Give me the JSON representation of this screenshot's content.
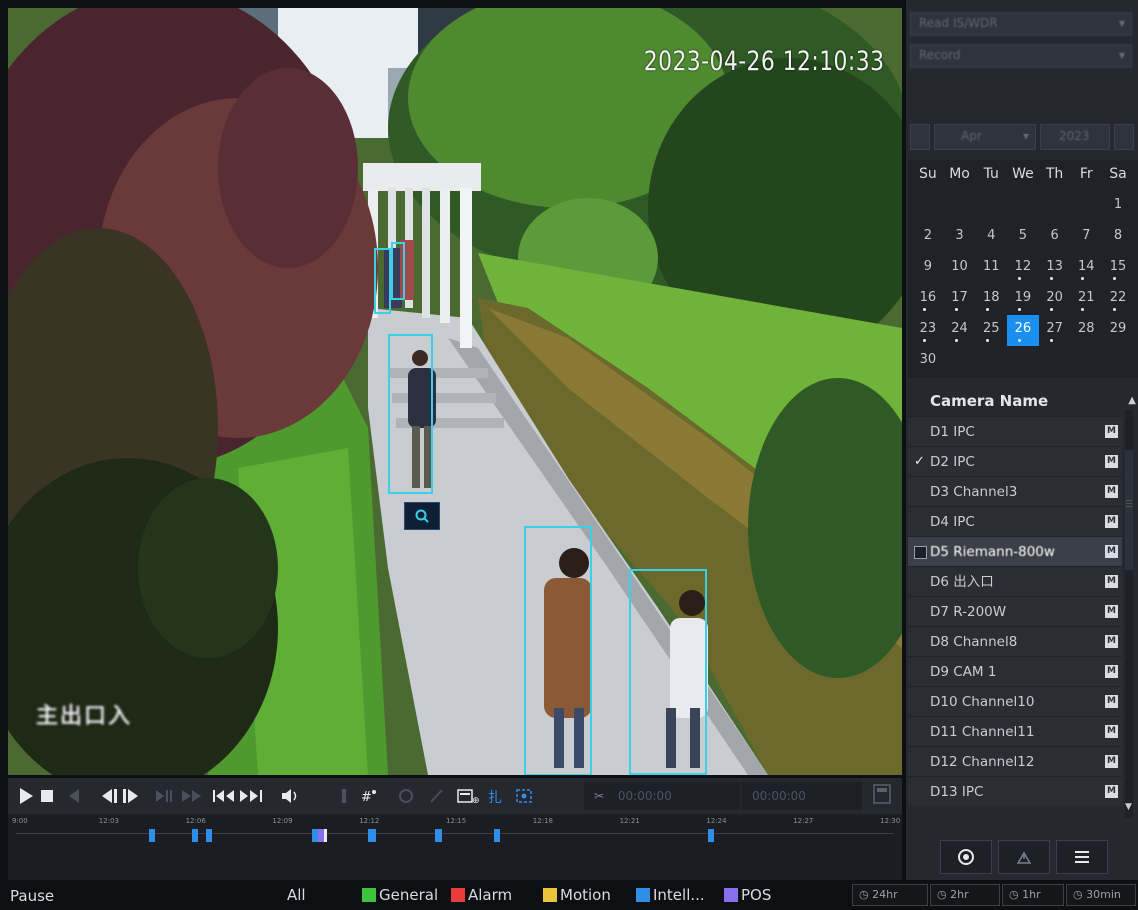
{
  "video": {
    "timestamp": "2023-04-26 12:10:33",
    "channel_label": "主出口入"
  },
  "panel": {
    "dropdown1": "Read IS/WDR",
    "dropdown2": "Record",
    "month": "Apr",
    "year": "2023",
    "weekdays": [
      "Su",
      "Mo",
      "Tu",
      "We",
      "Th",
      "Fr",
      "Sa"
    ],
    "days": [
      {
        "d": "",
        "dot": false
      },
      {
        "d": "",
        "dot": false
      },
      {
        "d": "",
        "dot": false
      },
      {
        "d": "",
        "dot": false
      },
      {
        "d": "",
        "dot": false
      },
      {
        "d": "",
        "dot": false
      },
      {
        "d": "1",
        "dot": false
      },
      {
        "d": "2",
        "dot": false
      },
      {
        "d": "3",
        "dot": false
      },
      {
        "d": "4",
        "dot": false
      },
      {
        "d": "5",
        "dot": false
      },
      {
        "d": "6",
        "dot": false
      },
      {
        "d": "7",
        "dot": false
      },
      {
        "d": "8",
        "dot": false
      },
      {
        "d": "9",
        "dot": false
      },
      {
        "d": "10",
        "dot": false
      },
      {
        "d": "11",
        "dot": false
      },
      {
        "d": "12",
        "dot": true
      },
      {
        "d": "13",
        "dot": true
      },
      {
        "d": "14",
        "dot": true
      },
      {
        "d": "15",
        "dot": true
      },
      {
        "d": "16",
        "dot": true
      },
      {
        "d": "17",
        "dot": true
      },
      {
        "d": "18",
        "dot": true
      },
      {
        "d": "19",
        "dot": true
      },
      {
        "d": "20",
        "dot": true
      },
      {
        "d": "21",
        "dot": true
      },
      {
        "d": "22",
        "dot": true
      },
      {
        "d": "23",
        "dot": true
      },
      {
        "d": "24",
        "dot": true
      },
      {
        "d": "25",
        "dot": true
      },
      {
        "d": "26",
        "dot": true,
        "selected": true
      },
      {
        "d": "27",
        "dot": true
      },
      {
        "d": "28",
        "dot": false
      },
      {
        "d": "29",
        "dot": false
      },
      {
        "d": "30",
        "dot": false
      }
    ],
    "camera_header": "Camera Name",
    "cameras": [
      {
        "name": "D1 IPC",
        "checked": false
      },
      {
        "name": "D2 IPC",
        "checked": true
      },
      {
        "name": "D3 Channel3",
        "checked": false
      },
      {
        "name": "D4 IPC",
        "checked": false
      },
      {
        "name": "D5 Riemann-800w",
        "checked": false,
        "highlight": true
      },
      {
        "name": "D6 出入口",
        "checked": false
      },
      {
        "name": "D7 R-200W",
        "checked": false
      },
      {
        "name": "D8 Channel8",
        "checked": false
      },
      {
        "name": "D9 CAM 1",
        "checked": false
      },
      {
        "name": "D10 Channel10",
        "checked": false
      },
      {
        "name": "D11 Channel11",
        "checked": false
      },
      {
        "name": "D12 Channel12",
        "checked": false
      },
      {
        "name": "D13 IPC",
        "checked": false
      }
    ],
    "camera_badge": "M"
  },
  "toolbar": {
    "start_time": "00:00:00",
    "end_time": "00:00:00"
  },
  "timeline": {
    "ticks": [
      "9:00",
      "12:03",
      "12:06",
      "12:09",
      "12:12",
      "12:15",
      "12:18",
      "12:21",
      "12:24",
      "12:27",
      "12:30"
    ]
  },
  "status": {
    "state": "Pause",
    "legend_all": "All",
    "legend": [
      {
        "label": "General",
        "color": "#3cc43c"
      },
      {
        "label": "Alarm",
        "color": "#e83c3c"
      },
      {
        "label": "Motion",
        "color": "#e8c43c"
      },
      {
        "label": "Intell...",
        "color": "#2f8fe8"
      },
      {
        "label": "POS",
        "color": "#8a6ef0"
      }
    ],
    "zoom": [
      "24hr",
      "2hr",
      "1hr",
      "30min"
    ]
  },
  "colors": {
    "accent": "#1a8ff0",
    "detection_box": "#3ad1e8"
  }
}
